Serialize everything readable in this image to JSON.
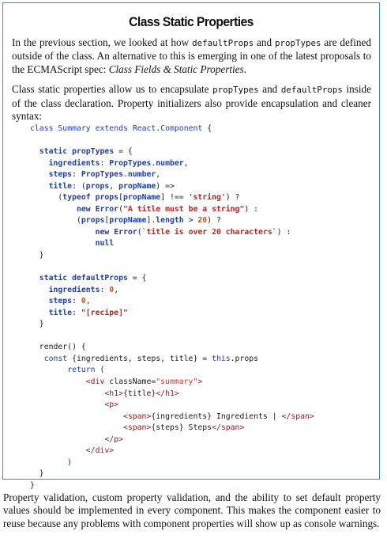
{
  "sidebar": {
    "title": "Class Static Properties",
    "para1": {
      "t1": "In the previous section, we looked at how ",
      "c1": "defaultProps",
      "t2": " and ",
      "c2": "propTypes",
      "t3": " are defined outside of the class. An alternative to this is emerging in one of the latest proposals to the ECMAScript spec: ",
      "em": "Class Fields & Static Properties",
      "t4": "."
    },
    "para2": {
      "t1": "Class static properties allow us to encapsulate ",
      "c1": "propTypes",
      "t2": " and ",
      "c2": "defaultProps",
      "t3": " inside of the class declaration. Property initializers also provide encapsulation and cleaner syntax:"
    },
    "code_lines": [
      "class Summary extends React.Component {",
      "",
      "  static propTypes = {",
      "    ingredients: PropTypes.number,",
      "    steps: PropTypes.number,",
      "    title: (props, propName) =>",
      "      (typeof props[propName] !== 'string') ?",
      "          new Error(\"A title must be a string\") :",
      "          (props[propName].length > 20) ?",
      "              new Error(`title is over 20 characters`) :",
      "              null",
      "  }",
      "",
      "  static defaultProps = {",
      "    ingredients: 0,",
      "    steps: 0,",
      "    title: \"[recipe]\"",
      "  }",
      "",
      "  render() {",
      "   const {ingredients, steps, title} = this.props",
      "        return (",
      "            <div className=\"summary\">",
      "                <h1>{title}</h1>",
      "                <p>",
      "                    <span>{ingredients} Ingredients | </span>",
      "                    <span>{steps} Steps</span>",
      "                </p>",
      "            </div>",
      "        )",
      "  }",
      "}"
    ]
  },
  "body_text": "Property validation, custom property validation, and the ability to set default property values should be implemented in every component. This makes the component easier to reuse because any problems with component properties will show up as console warnings.",
  "colors": {
    "border": "#3f8fa8",
    "keyword": "#1f3fa0",
    "string": "#b3261e",
    "number": "#c0581a",
    "tag": "#8b1a1a"
  }
}
